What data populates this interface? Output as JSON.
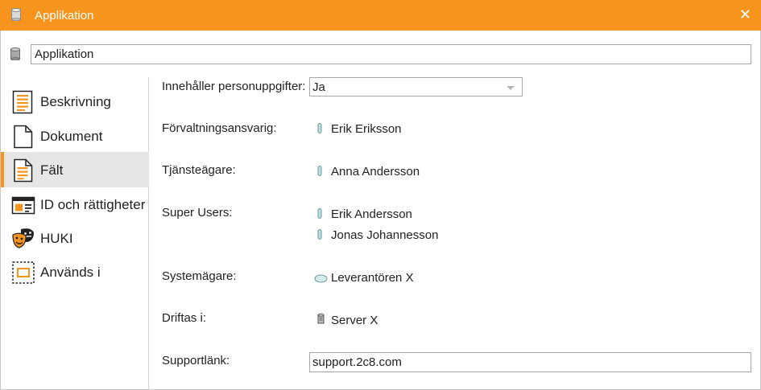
{
  "window": {
    "title": "Applikation",
    "accent_color": "#f7941d",
    "title_icon": "cylinder-icon",
    "close_icon": "close-icon"
  },
  "name_field": {
    "value": "Applikation",
    "icon": "cylinder-icon"
  },
  "sidebar": {
    "items": [
      {
        "label": "Beskrivning",
        "icon": "description-icon",
        "active": false
      },
      {
        "label": "Dokument",
        "icon": "document-icon",
        "active": false
      },
      {
        "label": "Fält",
        "icon": "fields-icon",
        "active": true
      },
      {
        "label": "ID och rättigheter",
        "icon": "id-card-icon",
        "active": false
      },
      {
        "label": "HUKI",
        "icon": "theater-masks-icon",
        "active": false
      },
      {
        "label": "Används i",
        "icon": "used-in-icon",
        "active": false
      }
    ]
  },
  "fields": {
    "personal_data": {
      "label": "Innehåller personuppgifter:",
      "value": "Ja"
    },
    "management": {
      "label": "Förvaltningsansvarig:",
      "values": [
        "Erik Eriksson"
      ],
      "icon": "person-icon"
    },
    "service_owner": {
      "label": "Tjänsteägare:",
      "values": [
        "Anna Andersson"
      ],
      "icon": "person-icon"
    },
    "super_users": {
      "label": "Super Users:",
      "values": [
        "Erik Andersson",
        "Jonas Johannesson"
      ],
      "icon": "person-icon"
    },
    "system_owner": {
      "label": "Systemägare:",
      "values": [
        "Leverantören X"
      ],
      "icon": "organization-icon"
    },
    "hosted_in": {
      "label": "Driftas i:",
      "values": [
        "Server X"
      ],
      "icon": "server-icon"
    },
    "support_link": {
      "label": "Supportlänk:",
      "value": "support.2c8.com"
    }
  }
}
